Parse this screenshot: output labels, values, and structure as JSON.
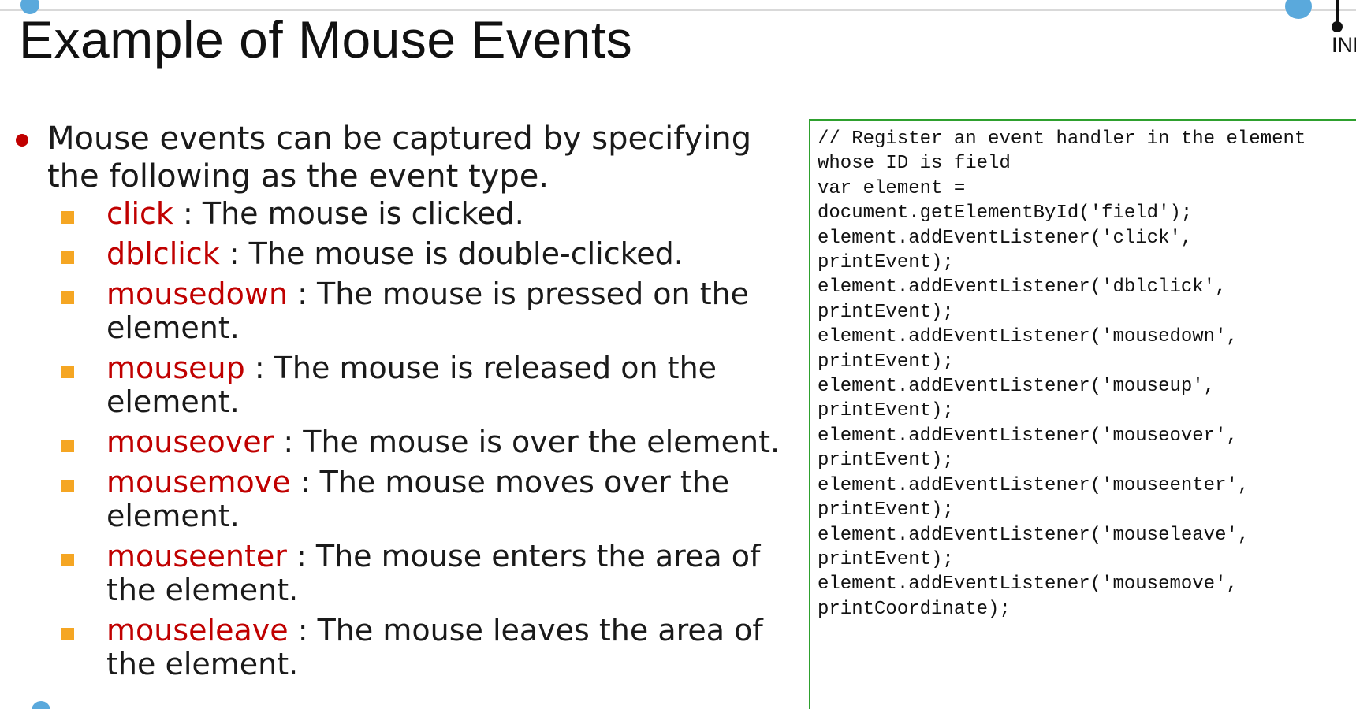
{
  "title": "Example of Mouse Events",
  "logo_text": "INI",
  "main_bullet": "Mouse events can be captured by specifying the following as the event type.",
  "events": [
    {
      "name": "click",
      "description": " : The mouse is clicked."
    },
    {
      "name": "dblclick",
      "description": " : The mouse is double-clicked."
    },
    {
      "name": "mousedown",
      "description": " : The mouse is pressed on the element."
    },
    {
      "name": "mouseup",
      "description": " : The mouse is released on the element."
    },
    {
      "name": "mouseover",
      "description": " : The mouse is over the element."
    },
    {
      "name": "mousemove",
      "description": " : The mouse moves over the element."
    },
    {
      "name": "mouseenter",
      "description": " : The mouse enters the area of the element."
    },
    {
      "name": "mouseleave",
      "description": " : The mouse leaves the area of the element."
    }
  ],
  "code_lines": [
    "// Register an event handler in the element",
    "whose ID is field",
    "var element =",
    "document.getElementById('field');",
    "element.addEventListener('click',",
    "printEvent);",
    "element.addEventListener('dblclick',",
    "printEvent);",
    "element.addEventListener('mousedown',",
    "printEvent);",
    "element.addEventListener('mouseup',",
    "printEvent);",
    "element.addEventListener('mouseover',",
    "printEvent);",
    "element.addEventListener('mouseenter',",
    "printEvent);",
    "element.addEventListener('mouseleave',",
    "printEvent);",
    "element.addEventListener('mousemove',",
    "printCoordinate);"
  ],
  "colors": {
    "event_name": "#c00000",
    "bullet": "#c00000",
    "sub_marker": "#f5a623",
    "code_border": "#2ea02e",
    "accent_circle": "#5aa9dc"
  }
}
